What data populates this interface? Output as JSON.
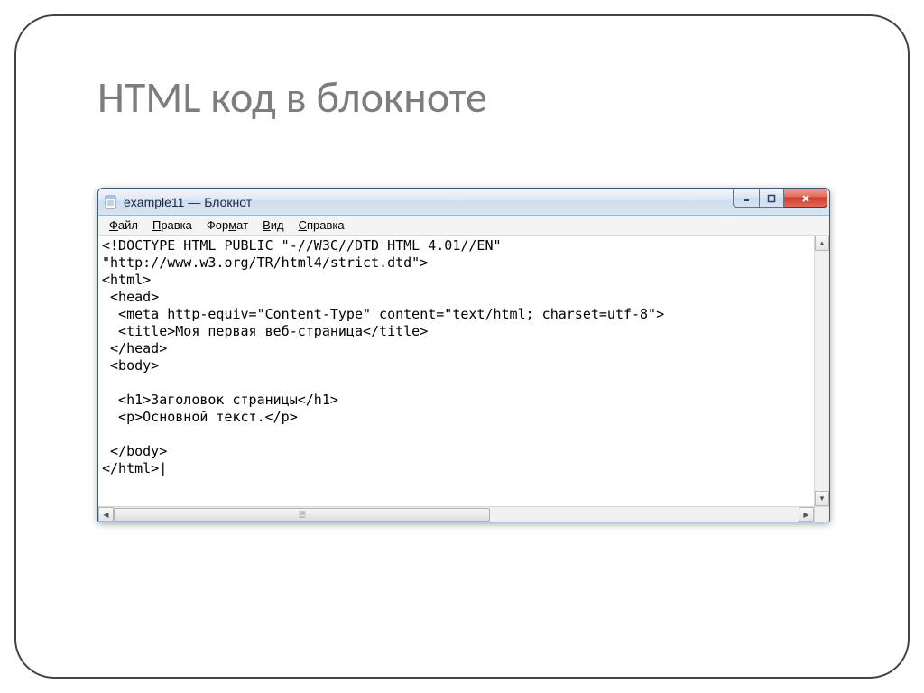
{
  "slide": {
    "title": "HTML код  в блокноте"
  },
  "window": {
    "title": "example11 — Блокнот",
    "menu": {
      "file": {
        "accel": "Ф",
        "rest": "айл"
      },
      "edit": {
        "accel": "П",
        "rest": "равка"
      },
      "format": {
        "accel": "Ф",
        "rest": "ормат",
        "pre": "Фор",
        "accel2": "м",
        "post": "ат"
      },
      "view": {
        "accel": "В",
        "rest": "ид"
      },
      "help": {
        "accel": "С",
        "rest": "правка"
      }
    },
    "content": "<!DOCTYPE HTML PUBLIC \"-//W3C//DTD HTML 4.01//EN\"\n\"http://www.w3.org/TR/html4/strict.dtd\">\n<html>\n <head>\n  <meta http-equiv=\"Content-Type\" content=\"text/html; charset=utf-8\">\n  <title>Моя первая веб-страница</title>\n </head>\n <body>\n\n  <h1>Заголовок страницы</h1>\n  <p>Основной текст.</p>\n\n </body>\n</html>|"
  }
}
